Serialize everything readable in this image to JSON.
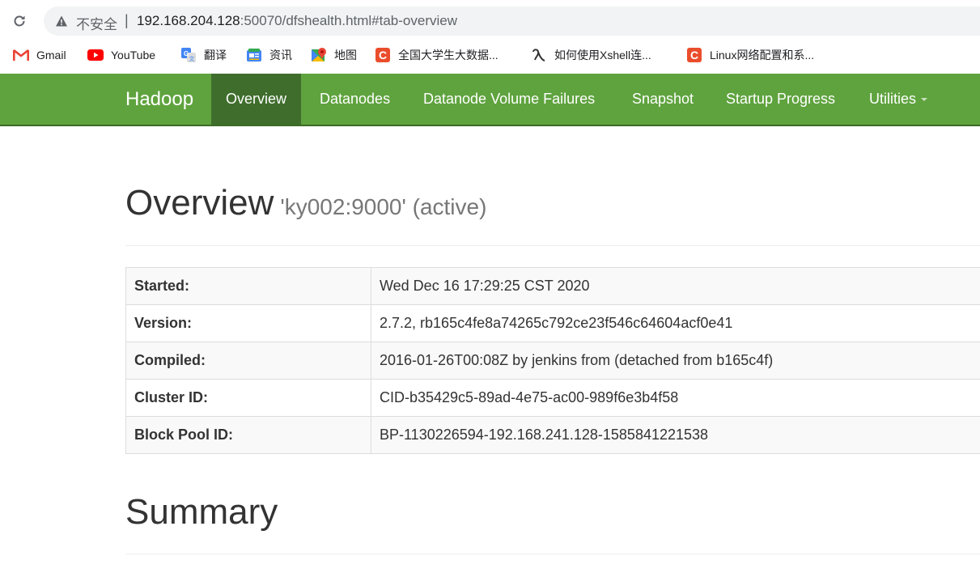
{
  "browser": {
    "security_label": "不安全",
    "separator": "|",
    "url_host": "192.168.204.128",
    "url_rest": ":50070/dfshealth.html#tab-overview"
  },
  "bookmarks": [
    {
      "label": "Gmail",
      "icon": "gmail-icon"
    },
    {
      "label": "YouTube",
      "icon": "youtube-icon"
    },
    {
      "label": "翻译",
      "icon": "translate-icon"
    },
    {
      "label": "资讯",
      "icon": "news-icon"
    },
    {
      "label": "地图",
      "icon": "maps-icon"
    },
    {
      "label": "全国大学生大数据...",
      "icon": "c-icon"
    },
    {
      "label": "如何使用Xshell连...",
      "icon": "xshell-icon"
    },
    {
      "label": "Linux网络配置和系...",
      "icon": "c-icon"
    }
  ],
  "navbar": {
    "brand": "Hadoop",
    "items": [
      {
        "label": "Overview",
        "active": true
      },
      {
        "label": "Datanodes"
      },
      {
        "label": "Datanode Volume Failures"
      },
      {
        "label": "Snapshot"
      },
      {
        "label": "Startup Progress"
      },
      {
        "label": "Utilities",
        "dropdown": true
      }
    ]
  },
  "overview": {
    "title": "Overview",
    "subtitle": "'ky002:9000' (active)",
    "rows": [
      {
        "key": "Started:",
        "value": "Wed Dec 16 17:29:25 CST 2020"
      },
      {
        "key": "Version:",
        "value": "2.7.2, rb165c4fe8a74265c792ce23f546c64604acf0e41"
      },
      {
        "key": "Compiled:",
        "value": "2016-01-26T00:08Z by jenkins from (detached from b165c4f)"
      },
      {
        "key": "Cluster ID:",
        "value": "CID-b35429c5-89ad-4e75-ac00-989f6e3b4f58"
      },
      {
        "key": "Block Pool ID:",
        "value": "BP-1130226594-192.168.241.128-1585841221538"
      }
    ]
  },
  "summary": {
    "title": "Summary"
  },
  "colors": {
    "navbar_bg": "#5fa33e",
    "navbar_active_bg": "#3f6e2c",
    "c_icon": "#ea4d2c"
  }
}
